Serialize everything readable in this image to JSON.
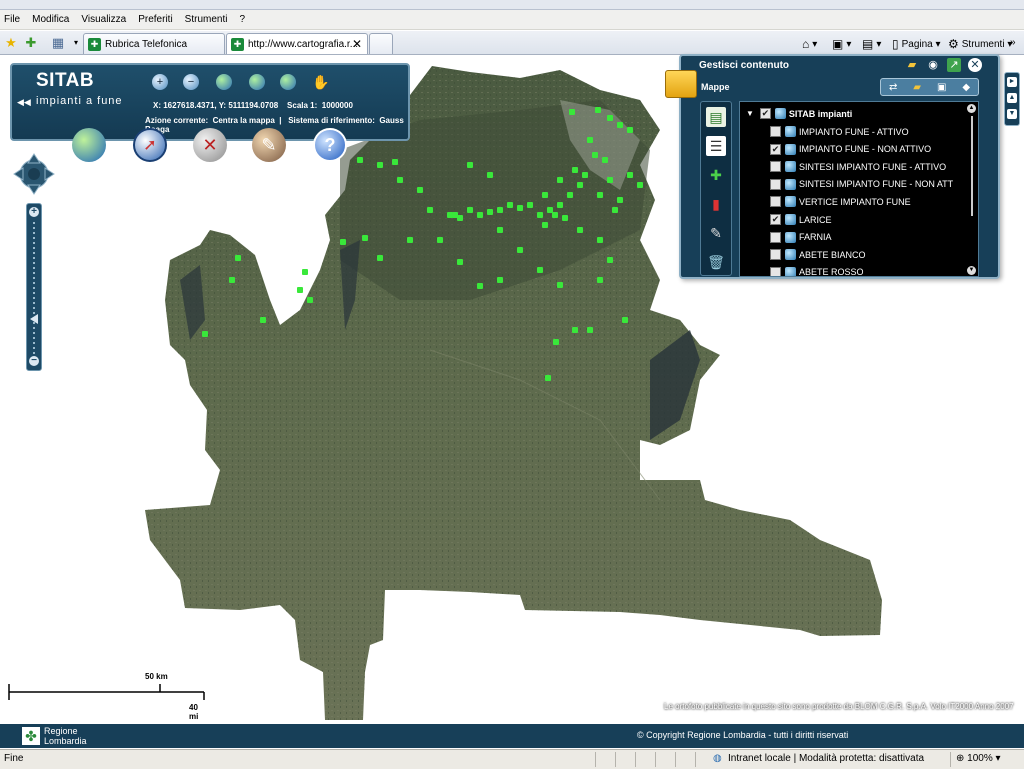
{
  "browser": {
    "menu": [
      "File",
      "Modifica",
      "Visualizza",
      "Preferiti",
      "Strumenti",
      "?"
    ],
    "tabs": [
      {
        "label": "Rubrica Telefonica",
        "active": false
      },
      {
        "label": "http://www.cartografia.r...",
        "active": true
      }
    ],
    "commands": {
      "page_label": "Pagina",
      "tools_label": "Strumenti"
    },
    "status": {
      "left": "Fine",
      "zone": "Intranet locale | Modalità protetta: disattivata",
      "zoom": "100%"
    }
  },
  "app": {
    "title": "SITAB",
    "subtitle": "impianti a fune",
    "coordinates": "X: 1627618.4371, Y: 5111194.0708",
    "scale_label": "Scala 1:",
    "scale_value": "1000000",
    "action_label": "Azione corrente:",
    "action_value": "Centra la mappa",
    "ref_label": "Sistema di riferimento:",
    "ref_value": "Gauss Boaga",
    "header_tools": [
      "zoom-in-icon",
      "zoom-out-icon",
      "globe-icon",
      "globe-back-icon",
      "globe-forward-icon",
      "hand-icon"
    ],
    "big_tools": [
      "world-icon",
      "compass-icon",
      "measure-icon",
      "identify-icon",
      "help-icon"
    ]
  },
  "panel": {
    "title": "Gestisci contenuto",
    "section": "Mappe",
    "root_layer": "SITAB impianti",
    "layers": [
      {
        "label": "IMPIANTO FUNE - ATTIVO",
        "checked": false
      },
      {
        "label": "IMPIANTO FUNE - NON ATTIVO",
        "checked": true
      },
      {
        "label": "SINTESI IMPIANTO FUNE - ATTIVO",
        "checked": false
      },
      {
        "label": "SINTESI IMPIANTO FUNE - NON ATT",
        "checked": false
      },
      {
        "label": "VERTICE IMPIANTO FUNE",
        "checked": false
      },
      {
        "label": "LARICE",
        "checked": true
      },
      {
        "label": "FARNIA",
        "checked": false
      },
      {
        "label": "ABETE BIANCO",
        "checked": false
      },
      {
        "label": "ABETE ROSSO",
        "checked": false
      }
    ]
  },
  "scale_bar": {
    "km_label": "50 km",
    "mi_label": "40 mi"
  },
  "map_credit": "Le ortofoto pubblicate in questo sito sono prodotte da BLOM C.G.R. S.p.A. Volo IT2000 Anno 2007",
  "footer": {
    "org_line1": "Regione",
    "org_line2": "Lombardia",
    "copyright": "© Copyright Regione Lombardia - tutti i diritti riservati"
  },
  "colors": {
    "panel_bg": "#173f58",
    "marker": "#39e83a",
    "terrain": "#5e6b4e"
  }
}
